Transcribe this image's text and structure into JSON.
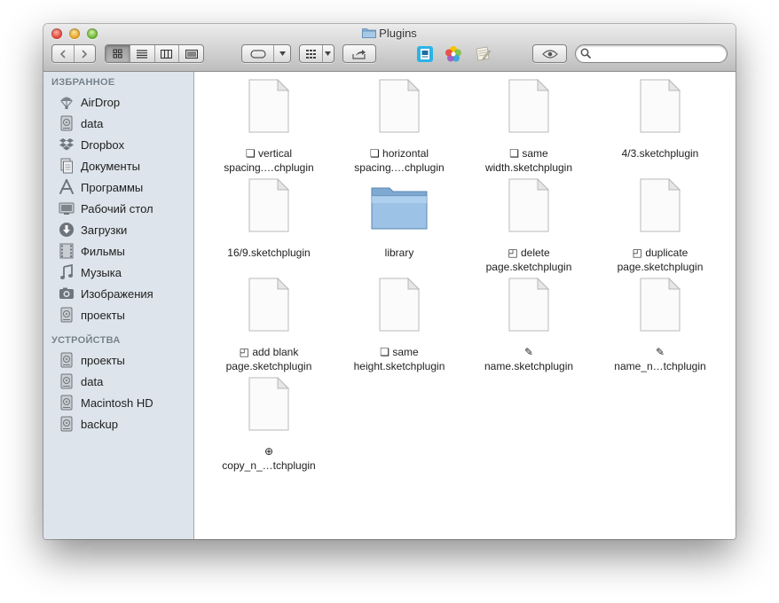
{
  "window": {
    "title": "Plugins"
  },
  "toolbar": {
    "back_icon": "chevron-left-icon",
    "forward_icon": "chevron-right-icon",
    "view_modes": [
      "icon-view",
      "list-view",
      "column-view",
      "cover-flow-view"
    ],
    "active_view": "icon-view",
    "search_placeholder": ""
  },
  "sidebar": {
    "favorites_header": "ИЗБРАННОЕ",
    "favorites": [
      {
        "label": "AirDrop",
        "icon": "airdrop-icon"
      },
      {
        "label": "data",
        "icon": "drive-icon"
      },
      {
        "label": "Dropbox",
        "icon": "dropbox-icon"
      },
      {
        "label": "Документы",
        "icon": "documents-icon"
      },
      {
        "label": "Программы",
        "icon": "applications-icon"
      },
      {
        "label": "Рабочий стол",
        "icon": "desktop-icon"
      },
      {
        "label": "Загрузки",
        "icon": "downloads-icon"
      },
      {
        "label": "Фильмы",
        "icon": "movies-icon"
      },
      {
        "label": "Музыка",
        "icon": "music-icon"
      },
      {
        "label": "Изображения",
        "icon": "pictures-icon"
      },
      {
        "label": "проекты",
        "icon": "drive-icon"
      }
    ],
    "devices_header": "УСТРОЙСТВА",
    "devices": [
      {
        "label": "проекты",
        "icon": "drive-icon"
      },
      {
        "label": "data",
        "icon": "drive-icon"
      },
      {
        "label": "Macintosh HD",
        "icon": "drive-icon"
      },
      {
        "label": "backup",
        "icon": "drive-icon"
      }
    ]
  },
  "files": [
    {
      "line1": "❏  vertical",
      "line2": "spacing.…chplugin",
      "type": "document"
    },
    {
      "line1": "❏  horizontal",
      "line2": "spacing.…chplugin",
      "type": "document"
    },
    {
      "line1": "❏  same",
      "line2": "width.sketchplugin",
      "type": "document"
    },
    {
      "line1": "4/3.sketchplugin",
      "line2": "",
      "type": "document"
    },
    {
      "line1": "16/9.sketchplugin",
      "line2": "",
      "type": "document"
    },
    {
      "line1": "library",
      "line2": "",
      "type": "folder"
    },
    {
      "line1": "◰  delete",
      "line2": "page.sketchplugin",
      "type": "document"
    },
    {
      "line1": "◰  duplicate",
      "line2": "page.sketchplugin",
      "type": "document"
    },
    {
      "line1": "◰  add blank",
      "line2": "page.sketchplugin",
      "type": "document"
    },
    {
      "line1": "❏  same",
      "line2": "height.sketchplugin",
      "type": "document"
    },
    {
      "line1": "✎",
      "line2": "name.sketchplugin",
      "type": "document"
    },
    {
      "line1": "✎",
      "line2": "name_n…tchplugin",
      "type": "document"
    },
    {
      "line1": "⊕",
      "line2": "copy_n_…tchplugin",
      "type": "document"
    }
  ]
}
